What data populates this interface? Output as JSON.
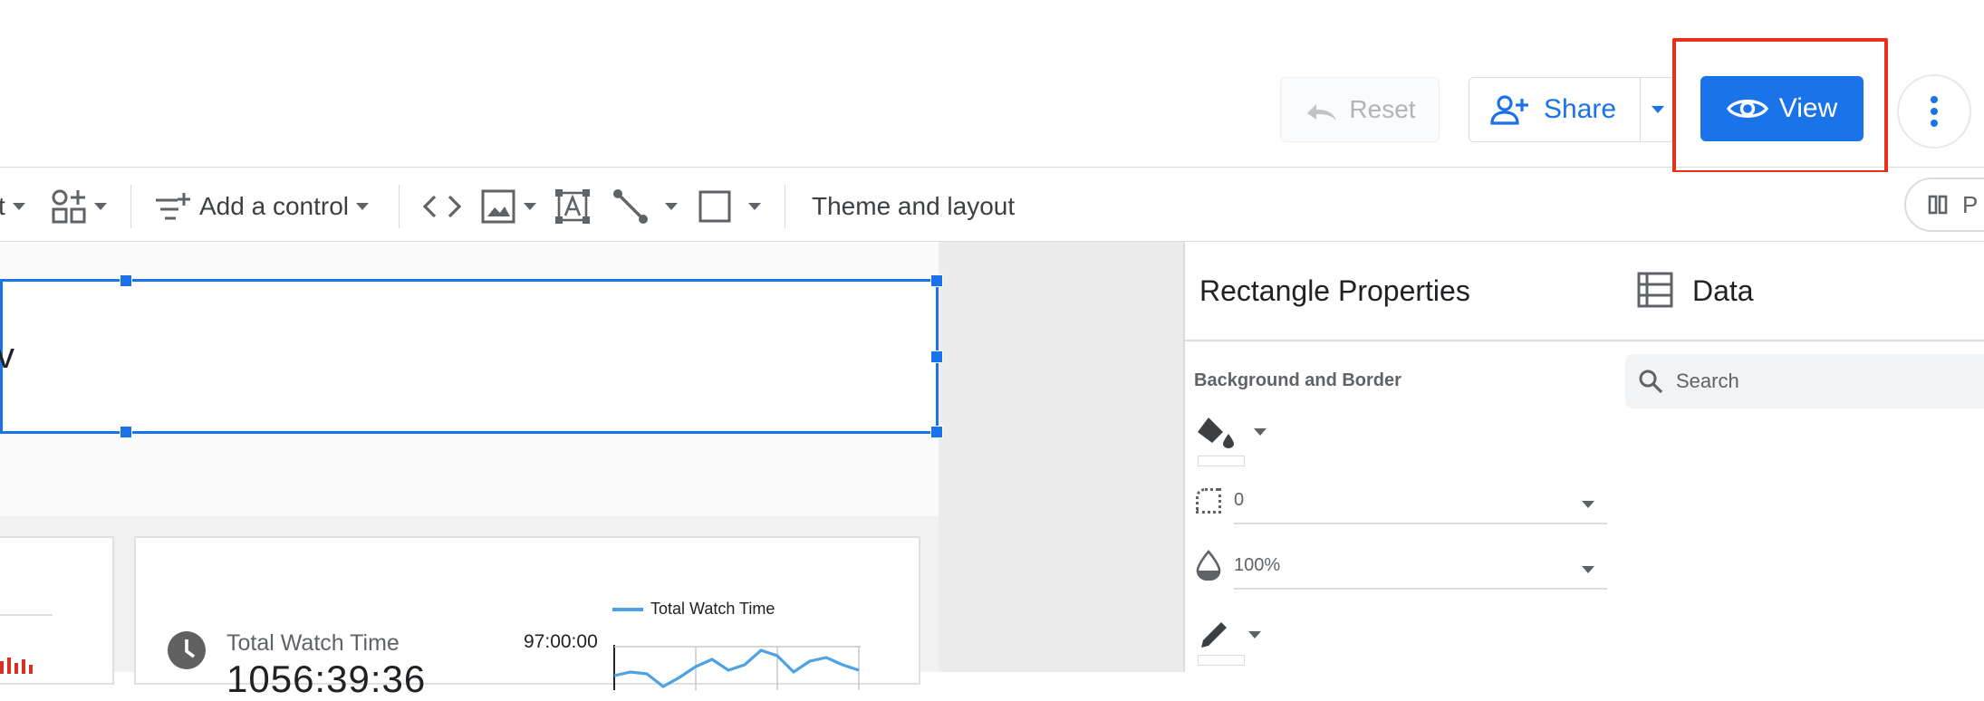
{
  "header": {
    "reset_label": "Reset",
    "share_label": "Share",
    "view_label": "View",
    "accent": "#1a73e8",
    "highlight_color": "#e8311b"
  },
  "toolbar": {
    "partial_label": "t",
    "add_control_label": "Add a control",
    "theme_label": "Theme and layout",
    "right_pill_label": "P",
    "items": [
      "add-chart-icon",
      "add-control-icon",
      "code-icon",
      "image-icon",
      "text-icon",
      "line-icon",
      "rectangle-icon"
    ]
  },
  "canvas": {
    "title_fragment": "v",
    "scorecard": {
      "label": "Total Watch Time",
      "value": "1056:39:36",
      "legend": "Total Watch Time",
      "axis_top": "97:00:00"
    },
    "scorecard_line_color": "#4ea1e4"
  },
  "properties_panel": {
    "title": "Rectangle Properties",
    "section": "Background and Border",
    "border_radius_value": "0",
    "opacity_value": "100%"
  },
  "data_panel": {
    "title": "Data",
    "search_placeholder": "Search"
  }
}
